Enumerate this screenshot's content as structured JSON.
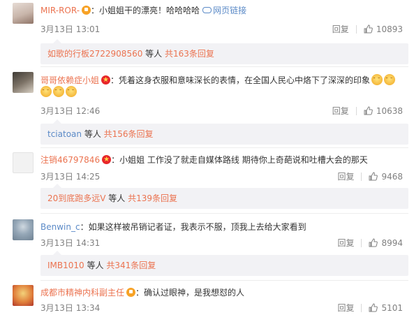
{
  "comments": [
    {
      "username": "MIR-ROR-",
      "text": "：小姐姐干的漂亮！哈哈哈哈",
      "web_link": "网页链接",
      "date": "3月13日 13:01",
      "reply_label": "回复",
      "likes": "10893",
      "reply_user": "如歌的行板2722908560",
      "reply_mid": " 等人 ",
      "reply_count": "共163条回复"
    },
    {
      "username": "哥哥依赖症小姐",
      "text": "：凭着这身衣服和意味深长的表情，在全国人民心中烙下了深深的印象",
      "date": "3月13日 12:46",
      "reply_label": "回复",
      "likes": "10638",
      "reply_user": "tciatoan",
      "reply_mid": " 等人 ",
      "reply_count": "共156条回复"
    },
    {
      "username": "注销46797846",
      "text": "：小姐姐 工作没了就走自媒体路线 期待你上奇葩说和吐槽大会的那天",
      "date": "3月13日 14:25",
      "reply_label": "回复",
      "likes": "9468",
      "reply_user": "20到底跑多远V",
      "reply_mid": " 等人 ",
      "reply_count": "共139条回复"
    },
    {
      "username": "Benwin_c",
      "text": "：如果这样被吊销记者证，我表示不服，顶我上去给大家看到",
      "date": "3月13日 14:31",
      "reply_label": "回复",
      "likes": "8994",
      "reply_user": "IMB1010",
      "reply_mid": " 等人 ",
      "reply_count": "共341条回复"
    },
    {
      "username": "成都市精神内科副主任",
      "text": "：确认过眼神，是我想怼的人",
      "date": "3月13日 13:34",
      "reply_label": "回复",
      "likes": "5101"
    }
  ],
  "colors": {
    "orange_name": "#eb7350",
    "blue_name": "#5b8ac7",
    "meta_gray": "#808080",
    "reply_bg": "#f2f2f5"
  }
}
